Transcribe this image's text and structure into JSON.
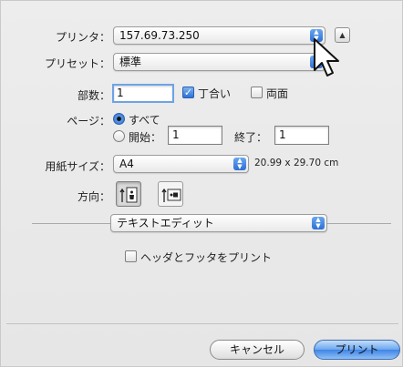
{
  "printer": {
    "label": "プリンタ：",
    "value": "157.69.73.250"
  },
  "preset": {
    "label": "プリセット：",
    "value": "標準"
  },
  "copies": {
    "label": "部数：",
    "value": "1",
    "collate_label": "丁合い",
    "collate_checked": true,
    "duplex_label": "両面",
    "duplex_checked": false
  },
  "pages": {
    "label": "ページ：",
    "all_label": "すべて",
    "from_label": "開始：",
    "from_value": "1",
    "to_label": "終了：",
    "to_value": "1",
    "selected": "all"
  },
  "paper": {
    "label": "用紙サイズ：",
    "value": "A4",
    "dimensions": "20.99 x 29.70 cm"
  },
  "orientation": {
    "label": "方向：",
    "options": [
      "portrait",
      "landscape"
    ],
    "selected": "portrait"
  },
  "panel": {
    "value": "テキストエディット",
    "header_footer_label": "ヘッダとフッタをプリント",
    "header_footer_checked": false
  },
  "buttons": {
    "cancel": "キャンセル",
    "print": "プリント"
  },
  "colors": {
    "accent": "#3f84e6"
  }
}
